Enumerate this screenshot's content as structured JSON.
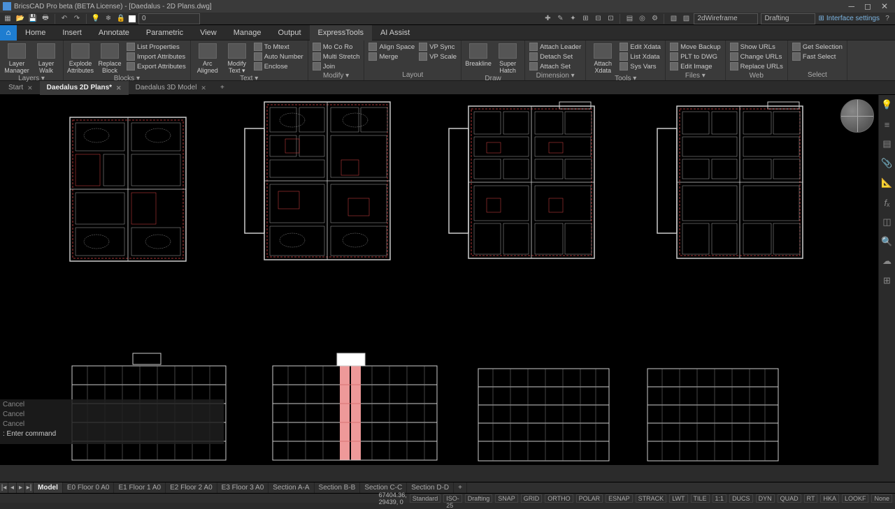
{
  "title": "BricsCAD Pro beta (BETA License) - [Daedalus - 2D Plans.dwg]",
  "qat": {
    "layer_value": "0"
  },
  "visual_style": "2dWireframe",
  "workspace": "Drafting",
  "interface_settings": "Interface settings",
  "tabs": [
    "Home",
    "Insert",
    "Annotate",
    "Parametric",
    "View",
    "Manage",
    "Output",
    "ExpressTools",
    "AI Assist"
  ],
  "active_tab": "ExpressTools",
  "ribbon": {
    "layers": {
      "label": "Layers ▾",
      "btns": [
        "Layer Manager",
        "Layer Walk"
      ]
    },
    "blocks": {
      "label": "Blocks ▾",
      "big": [
        "Explode Attributes",
        "Replace Block"
      ],
      "sm": [
        "List Properties",
        "Import Attributes",
        "Export Attributes"
      ]
    },
    "text": {
      "label": "Text ▾",
      "big": [
        "Arc Aligned",
        "Modify Text ▾"
      ],
      "sm": [
        "To Mtext",
        "Auto Number",
        "Enclose"
      ]
    },
    "modify": {
      "label": "Modify ▾",
      "sm": [
        "Mo Co Ro",
        "Multi Stretch",
        "Join"
      ]
    },
    "layout": {
      "label": "Layout",
      "sm": [
        "Align Space",
        "Merge",
        "VP Sync",
        "VP Scale"
      ]
    },
    "draw": {
      "label": "Draw",
      "big": [
        "Breakline",
        "Super Hatch"
      ]
    },
    "dimension": {
      "label": "Dimension ▾",
      "sm": [
        "Attach Leader",
        "Detach Set",
        "Attach Set"
      ]
    },
    "tools": {
      "label": "Tools ▾",
      "big": [
        "Attach Xdata"
      ],
      "sm": [
        "Edit Xdata",
        "List Xdata",
        "Sys Vars"
      ]
    },
    "files": {
      "label": "Files ▾",
      "sm": [
        "Move Backup",
        "PLT to DWG",
        "Edit Image"
      ]
    },
    "web": {
      "label": "Web",
      "sm": [
        "Show URLs",
        "Change URLs",
        "Replace URLs"
      ]
    },
    "select": {
      "label": "Select",
      "sm": [
        "Get Selection",
        "Fast Select"
      ]
    }
  },
  "doctabs": [
    {
      "label": "Start",
      "closable": true,
      "active": false
    },
    {
      "label": "Daedalus 2D Plans*",
      "closable": true,
      "active": true
    },
    {
      "label": "Daedalus 3D Model",
      "closable": true,
      "active": false
    }
  ],
  "cmd_history": [
    "Cancel",
    "Cancel",
    "Cancel"
  ],
  "cmd_prompt": ": Enter command",
  "layout_tabs": [
    "Model",
    "E0 Floor 0 A0",
    "E1 Floor 1 A0",
    "E2 Floor 2 A0",
    "E3 Floor 3 A0",
    "Section A-A",
    "Section B-B",
    "Section C-C",
    "Section D-D",
    "+"
  ],
  "active_layout": "Model",
  "status": {
    "coords": "67404.36, 29439, 0",
    "standard": "Standard",
    "iso": "ISO-25",
    "ws": "Drafting",
    "toggles": [
      "SNAP",
      "GRID",
      "ORTHO",
      "POLAR",
      "ESNAP",
      "STRACK",
      "LWT",
      "TILE",
      "1:1",
      "DUCS",
      "DYN",
      "QUAD",
      "RT",
      "HKA",
      "LOOKF"
    ],
    "none": "None"
  }
}
